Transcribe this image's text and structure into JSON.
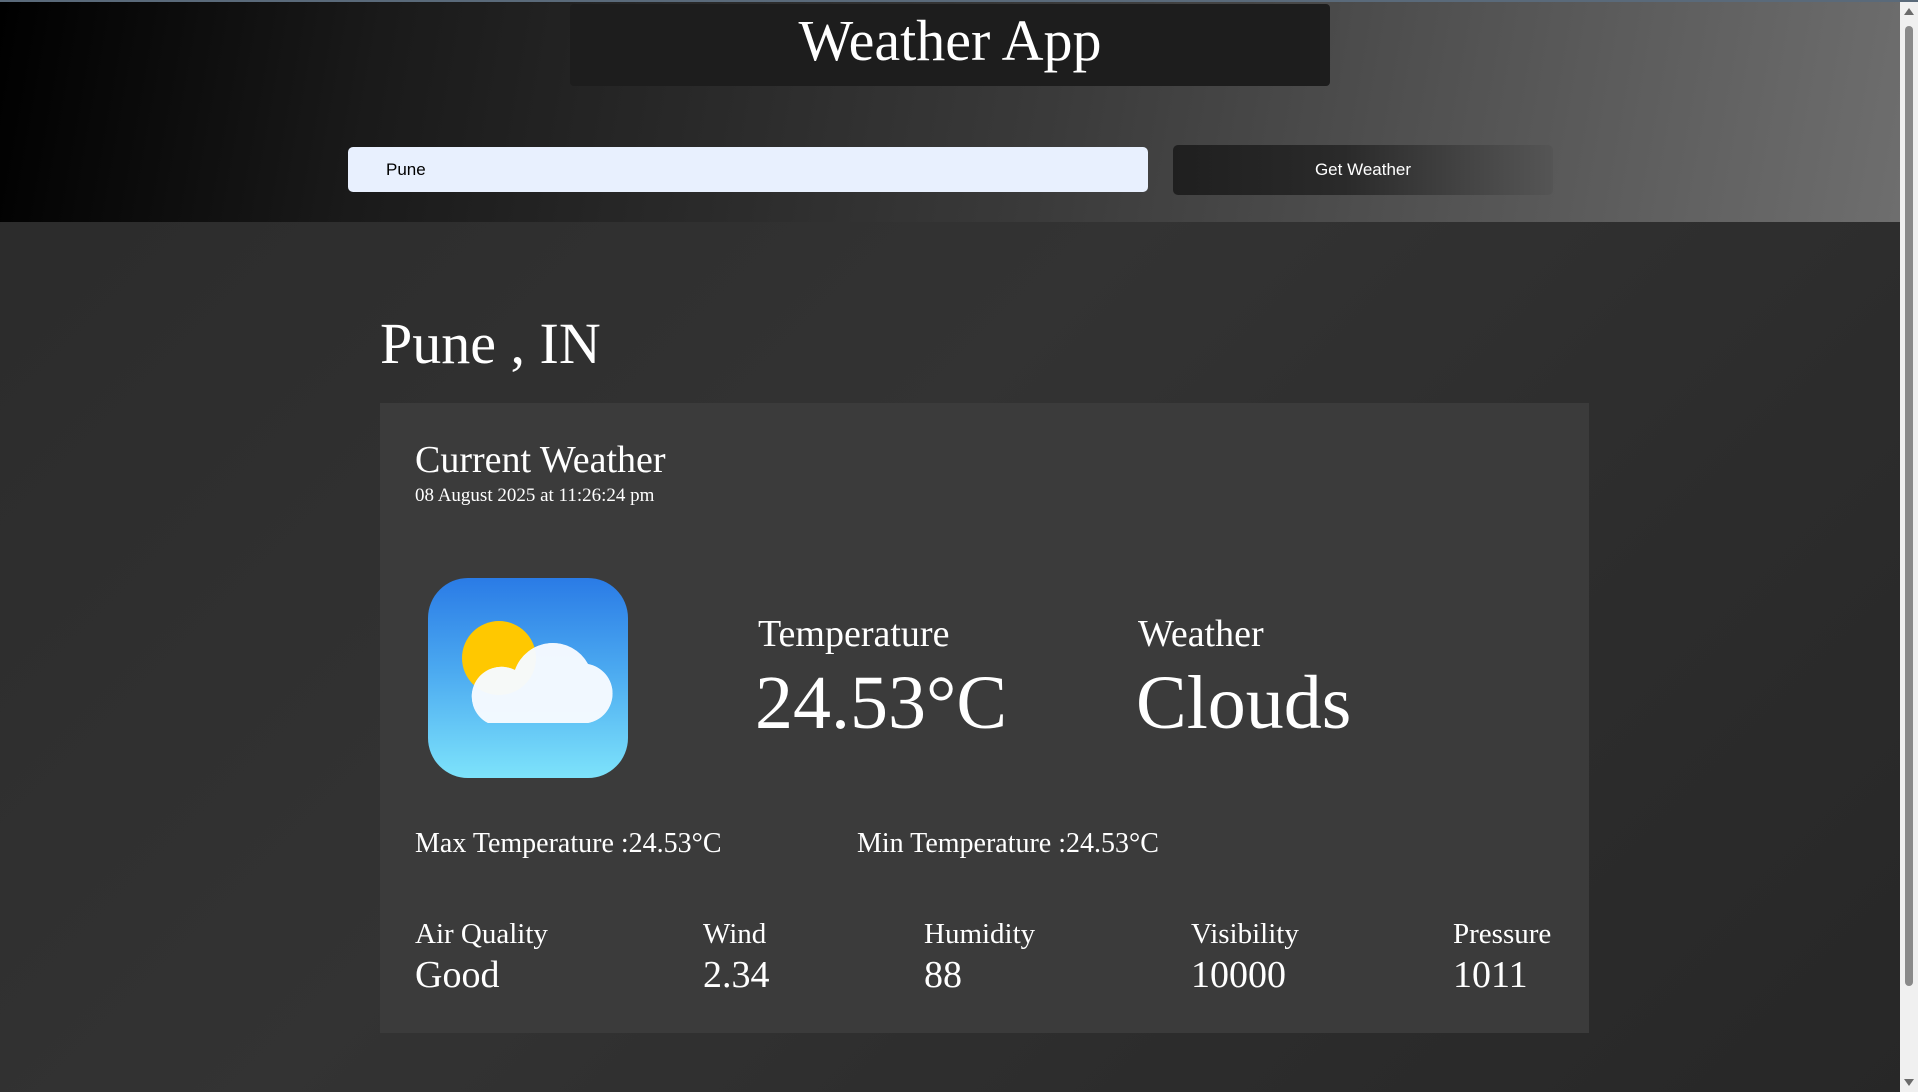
{
  "header": {
    "title": "Weather App",
    "search_value": "Pune",
    "button_label": "Get Weather"
  },
  "location": {
    "city_line": "Pune , IN"
  },
  "current": {
    "heading": "Current Weather",
    "datetime": "08 August 2025 at 11:26:24 pm",
    "icon": "partly-cloudy-icon",
    "temperature_label": "Temperature",
    "temperature_value": "24.53°C",
    "weather_label": "Weather",
    "weather_value": "Clouds",
    "max_temp_text": "Max Temperature :24.53°C",
    "min_temp_text": "Min Temperature :24.53°C"
  },
  "metrics": [
    {
      "label": "Air Quality",
      "value": "Good"
    },
    {
      "label": "Wind",
      "value": "2.34"
    },
    {
      "label": "Humidity",
      "value": "88"
    },
    {
      "label": "Visibility",
      "value": "10000"
    },
    {
      "label": "Pressure",
      "value": "1011"
    }
  ],
  "colors": {
    "input_bg": "#e8f0fe",
    "card_bg": "#3b3b3b",
    "icon_gradient_top": "#2a7be6",
    "icon_gradient_bottom": "#7de3fb",
    "sun": "#ffc800"
  }
}
